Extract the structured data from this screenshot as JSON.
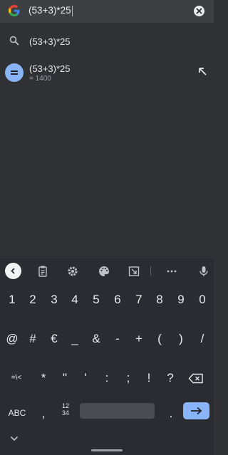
{
  "search": {
    "query": "(53+3)*25"
  },
  "suggestions": [
    {
      "text": "(53+3)*25"
    },
    {
      "text": "(53+3)*25",
      "result": "= 1400"
    }
  ],
  "keyboard": {
    "toolbar_icons": [
      "back-icon",
      "clipboard-icon",
      "gear-icon",
      "palette-icon",
      "resize-icon",
      "more-icon",
      "mic-icon"
    ],
    "row_numbers": [
      "1",
      "2",
      "3",
      "4",
      "5",
      "6",
      "7",
      "8",
      "9",
      "0"
    ],
    "row_symbols1": [
      "@",
      "#",
      "€",
      "_",
      "&",
      "-",
      "+",
      "(",
      ")",
      "/"
    ],
    "row_symbols2": [
      "=\\<",
      "*",
      "\"",
      "'",
      ":",
      ";",
      "!",
      "?"
    ],
    "abc_label": "ABC",
    "comma": ",",
    "numpad_top": "12",
    "numpad_bottom": "34",
    "period": "."
  },
  "colors": {
    "accent": "#8ab4f8",
    "background": "#303134",
    "keyboard": "#2b2c31"
  }
}
